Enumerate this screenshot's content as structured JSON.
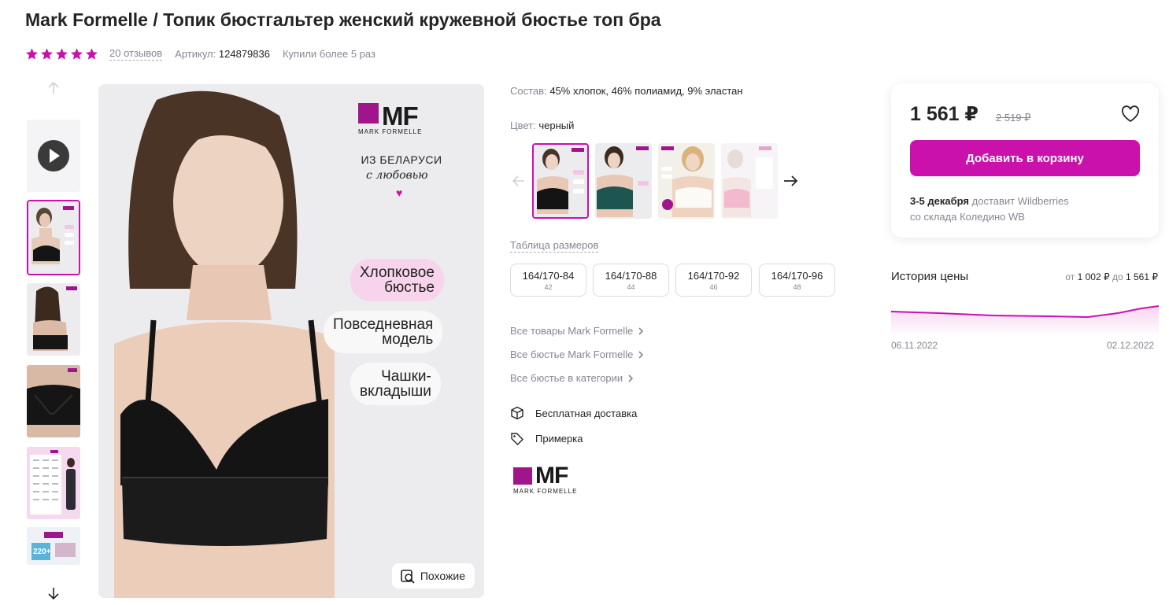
{
  "product": {
    "title": "Mark Formelle / Топик бюстгальтер женский кружевной бюстье топ бра",
    "rating": 5,
    "reviews": "20 отзывов",
    "article_label": "Артикул:",
    "article_value": "124879836",
    "bought": "Купили более 5 раз"
  },
  "main_image": {
    "brand_text": "MF",
    "brand_subtitle": "MARK FORMELLE",
    "from_country": "ИЗ БЕЛАРУСИ",
    "with_love": "с любовью",
    "pills": [
      {
        "line1": "Хлопковое",
        "line2": "бюстье"
      },
      {
        "line1": "Повседневная",
        "line2": "модель"
      },
      {
        "line1": "Чашки-",
        "line2": "вкладыши"
      }
    ],
    "similar_button": "Похожие"
  },
  "thumbnail_texts": {
    "size_chart_badge": "220+"
  },
  "info": {
    "composition_label": "Состав:",
    "composition_value": "45% хлопок, 46% полиамид, 9% эластан",
    "color_label": "Цвет:",
    "color_value": "черный",
    "size_table_link": "Таблица размеров",
    "sizes": [
      {
        "size": "164/170-84",
        "ru": "42"
      },
      {
        "size": "164/170-88",
        "ru": "44"
      },
      {
        "size": "164/170-92",
        "ru": "46"
      },
      {
        "size": "164/170-96",
        "ru": "48"
      }
    ],
    "links": [
      "Все товары Mark Formelle",
      "Все бюстье Mark Formelle",
      "Все бюстье в категории"
    ],
    "features": [
      "Бесплатная доставка",
      "Примерка"
    ],
    "brand_logo_text": "MF",
    "brand_logo_subtitle": "MARK FORMELLE"
  },
  "buy": {
    "price": "1 561 ₽",
    "old_price": "2 519 ₽",
    "add_to_cart": "Добавить в корзину",
    "delivery_date": "3-5 декабря",
    "delivery_by": "доставит Wildberries",
    "delivery_from": "со склада Коледино WB"
  },
  "price_history": {
    "title": "История цены",
    "range_from_label": "от",
    "range_from": "1 002 ₽",
    "range_to_label": "до",
    "range_to": "1 561 ₽",
    "date_start": "06.11.2022",
    "date_end": "02.12.2022"
  },
  "colors": {
    "accent": "#cb11ab",
    "text": "#242424",
    "muted": "#868695"
  }
}
